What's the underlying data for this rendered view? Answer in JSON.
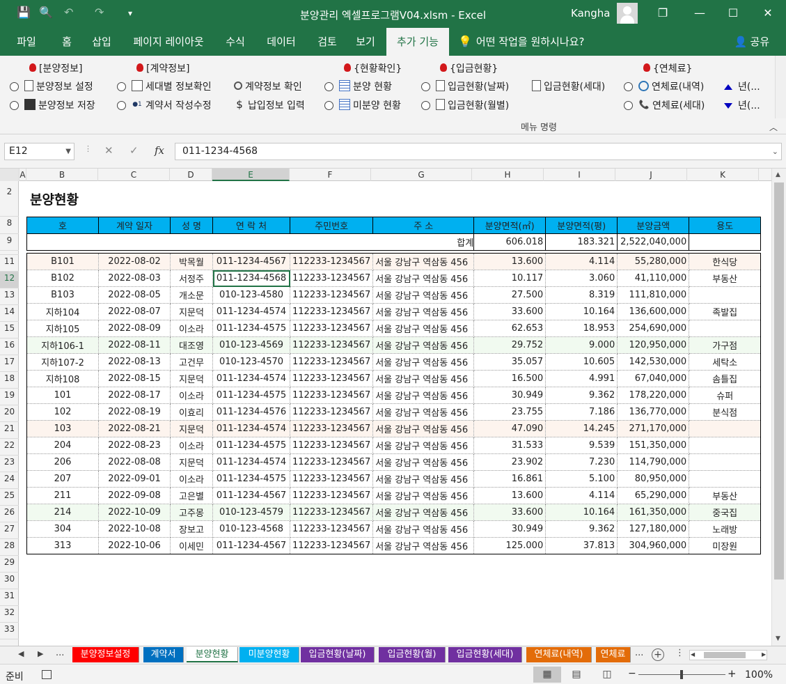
{
  "window": {
    "title": "분양관리 엑셀프로그램V04.xlsm  -  Excel",
    "user": "Kangha",
    "minimize": "—",
    "restore": "❐",
    "maximize": "☐",
    "close": "✕"
  },
  "quick_access": {
    "save": "💾",
    "preview": "🔍",
    "undo": "↶",
    "redo": "↷",
    "more": "▾"
  },
  "ribbon_tabs": [
    "파일",
    "홈",
    "삽입",
    "페이지 레이아웃",
    "수식",
    "데이터",
    "검토",
    "보기",
    "추가 기능"
  ],
  "tell_me": "어떤 작업을 원하시나요?",
  "share": "공유",
  "ribbon": {
    "headers": [
      "[분양정보]",
      "[계약정보]",
      "{현황확인}",
      "{입금현황}",
      "{연체료}"
    ],
    "items": [
      "분양정보 설정",
      "분양정보 저장",
      "세대별 정보확인",
      "계약서 작성수정",
      "계약정보 확인",
      "납입정보 입력",
      "분양 현황",
      "미분양 현황",
      "입금현황(날짜)",
      "입금현황(월별)",
      "입금현황(세대)",
      "연체료(내역)",
      "연체료(세대)",
      "년(...",
      "년(..."
    ],
    "group_label": "메뉴 명령",
    "collapse": "︿"
  },
  "formula_bar": {
    "name_box": "E12",
    "cancel": "✕",
    "enter": "✓",
    "fx": "fx",
    "value": "011-1234-4568"
  },
  "columns": [
    "A",
    "B",
    "C",
    "D",
    "E",
    "F",
    "G",
    "H",
    "I",
    "J",
    "K"
  ],
  "selected_column": "E",
  "row_numbers": [
    "2",
    "8",
    "9",
    "11",
    "12",
    "13",
    "14",
    "15",
    "16",
    "17",
    "18",
    "19",
    "20",
    "21",
    "22",
    "23",
    "24",
    "25",
    "26",
    "27",
    "28",
    "29",
    "30",
    "31",
    "32",
    "33"
  ],
  "selected_row": "12",
  "sheet_title": "분양현황",
  "table": {
    "headers": [
      "호",
      "계약 일자",
      "성  명",
      "연 락 처",
      "주민번호",
      "주    소",
      "분양면적(㎡)",
      "분양면적(평)",
      "분양금액",
      "용도"
    ],
    "total_label": "합계",
    "total_area_m2": "606.018",
    "total_area_py": "183.321",
    "total_amount": "2,522,040,000",
    "rows": [
      [
        "B101",
        "2022-08-02",
        "박목월",
        "011-1234-4567",
        "112233-1234567",
        "서울 강남구 역삼동 456",
        "13.600",
        "4.114",
        "55,280,000",
        "한식당"
      ],
      [
        "B102",
        "2022-08-03",
        "서정주",
        "011-1234-4568",
        "112233-1234567",
        "서울 강남구 역삼동 456",
        "10.117",
        "3.060",
        "41,110,000",
        "부동산"
      ],
      [
        "B103",
        "2022-08-05",
        "개소문",
        "010-123-4580",
        "112233-1234567",
        "서울 강남구 역삼동 456",
        "27.500",
        "8.319",
        "111,810,000",
        ""
      ],
      [
        "지하104",
        "2022-08-07",
        "지문덕",
        "011-1234-4574",
        "112233-1234567",
        "서울 강남구 역삼동 456",
        "33.600",
        "10.164",
        "136,600,000",
        "족발집"
      ],
      [
        "지하105",
        "2022-08-09",
        "이소라",
        "011-1234-4575",
        "112233-1234567",
        "서울 강남구 역삼동 456",
        "62.653",
        "18.953",
        "254,690,000",
        ""
      ],
      [
        "지하106-1",
        "2022-08-11",
        "대조영",
        "010-123-4569",
        "112233-1234567",
        "서울 강남구 역삼동 456",
        "29.752",
        "9.000",
        "120,950,000",
        "가구점"
      ],
      [
        "지하107-2",
        "2022-08-13",
        "고건무",
        "010-123-4570",
        "112233-1234567",
        "서울 강남구 역삼동 456",
        "35.057",
        "10.605",
        "142,530,000",
        "세탁소"
      ],
      [
        "지하108",
        "2022-08-15",
        "지문덕",
        "011-1234-4574",
        "112233-1234567",
        "서울 강남구 역삼동 456",
        "16.500",
        "4.991",
        "67,040,000",
        "솜틀집"
      ],
      [
        "101",
        "2022-08-17",
        "이소라",
        "011-1234-4575",
        "112233-1234567",
        "서울 강남구 역삼동 456",
        "30.949",
        "9.362",
        "178,220,000",
        "슈퍼"
      ],
      [
        "102",
        "2022-08-19",
        "이효리",
        "011-1234-4576",
        "112233-1234567",
        "서울 강남구 역삼동 456",
        "23.755",
        "7.186",
        "136,770,000",
        "분식점"
      ],
      [
        "103",
        "2022-08-21",
        "지문덕",
        "011-1234-4574",
        "112233-1234567",
        "서울 강남구 역삼동 456",
        "47.090",
        "14.245",
        "271,170,000",
        ""
      ],
      [
        "204",
        "2022-08-23",
        "이소라",
        "011-1234-4575",
        "112233-1234567",
        "서울 강남구 역삼동 456",
        "31.533",
        "9.539",
        "151,350,000",
        ""
      ],
      [
        "206",
        "2022-08-08",
        "지문덕",
        "011-1234-4574",
        "112233-1234567",
        "서울 강남구 역삼동 456",
        "23.902",
        "7.230",
        "114,790,000",
        ""
      ],
      [
        "207",
        "2022-09-01",
        "이소라",
        "011-1234-4575",
        "112233-1234567",
        "서울 강남구 역삼동 456",
        "16.861",
        "5.100",
        "80,950,000",
        ""
      ],
      [
        "211",
        "2022-09-08",
        "고은별",
        "011-1234-4567",
        "112233-1234567",
        "서울 강남구 역삼동 456",
        "13.600",
        "4.114",
        "65,290,000",
        "부동산"
      ],
      [
        "214",
        "2022-10-09",
        "고주몽",
        "010-123-4579",
        "112233-1234567",
        "서울 강남구 역삼동 456",
        "33.600",
        "10.164",
        "161,350,000",
        "중국집"
      ],
      [
        "304",
        "2022-10-08",
        "장보고",
        "010-123-4568",
        "112233-1234567",
        "서울 강남구 역삼동 456",
        "30.949",
        "9.362",
        "127,180,000",
        "노래방"
      ],
      [
        "313",
        "2022-10-06",
        "이세민",
        "011-1234-4567",
        "112233-1234567",
        "서울 강남구 역삼동 456",
        "125.000",
        "37.813",
        "304,960,000",
        "미장원"
      ]
    ]
  },
  "sheet_tabs": [
    {
      "label": "분양정보설정",
      "color": "#ff0000"
    },
    {
      "label": "계약서",
      "color": "#0070c0"
    },
    {
      "label": "분양현황",
      "color": "#ffffff"
    },
    {
      "label": "미분양현황",
      "color": "#00b0f0"
    },
    {
      "label": "입금현황(날짜)",
      "color": "#7030a0"
    },
    {
      "label": "입금현황(월)",
      "color": "#7030a0"
    },
    {
      "label": "입금현황(세대)",
      "color": "#7030a0"
    },
    {
      "label": "연체료(내역)",
      "color": "#e36c09"
    },
    {
      "label": "연체료",
      "color": "#e36c09"
    }
  ],
  "active_sheet": "분양현황",
  "tab_nav": {
    "prev": "◀",
    "next": "▶",
    "more_left": "...",
    "more_right": "...",
    "add": "+"
  },
  "status": {
    "ready": "준비",
    "zoom": "100%",
    "zoom_level_percent": 100,
    "minus": "−",
    "plus": "+"
  },
  "colors": {
    "accent": "#217346",
    "header_fill": "#00b0f0"
  }
}
